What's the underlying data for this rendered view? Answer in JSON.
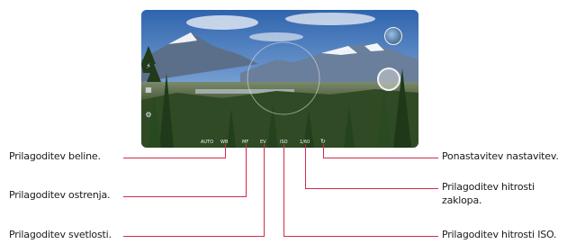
{
  "camera": {
    "left_icons": [
      "flash-icon",
      "grid-icon",
      "settings-icon"
    ],
    "bottom_bar": {
      "auto_label": "AUTO",
      "wb_label": "WB",
      "focus_label": "MF",
      "ev_label": "EV",
      "iso_label": "ISO",
      "shutter_label": "1/60"
    }
  },
  "callouts": {
    "white_balance": "Prilagoditev beline.",
    "focus": "Prilagoditev ostrenja.",
    "brightness": "Prilagoditev svetlosti.",
    "reset": "Ponastavitev nastavitev.",
    "shutter_speed_line1": "Prilagoditev hitrosti",
    "shutter_speed_line2": "zaklopa.",
    "iso": "Prilagoditev hitrosti ISO."
  },
  "colors": {
    "callout_line": "#d22b4c"
  }
}
